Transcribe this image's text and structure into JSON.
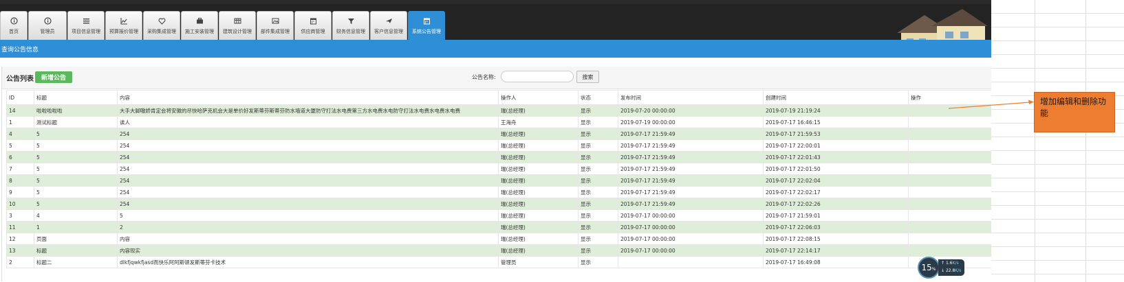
{
  "nav": {
    "tabs": [
      {
        "label": "首页",
        "icon": "info-icon"
      },
      {
        "label": "管理员",
        "icon": "info-icon"
      },
      {
        "label": "项目信息管理",
        "icon": "list-icon"
      },
      {
        "label": "预算报价管理",
        "icon": "chart-icon"
      },
      {
        "label": "采购集成管理",
        "icon": "heart-icon"
      },
      {
        "label": "施工安装管理",
        "icon": "briefcase-icon"
      },
      {
        "label": "建筑设计管理",
        "icon": "table-icon"
      },
      {
        "label": "部件集成管理",
        "icon": "picture-icon"
      },
      {
        "label": "供应商管理",
        "icon": "calendar-icon"
      },
      {
        "label": "财务信息管理",
        "icon": "filter-icon"
      },
      {
        "label": "客户信息管理",
        "icon": "plane-icon"
      },
      {
        "label": "系统公告管理",
        "icon": "calendar-icon"
      }
    ],
    "active_index": 11
  },
  "page_title": "查询公告信息",
  "toolbar": {
    "list_title": "公告列表",
    "add_button": "新增公告",
    "search_label": "公告名称:",
    "search_value": "",
    "search_button": "搜索"
  },
  "table": {
    "headers": [
      "ID",
      "标题",
      "内容",
      "操作人",
      "状态",
      "发布时间",
      "创建时间",
      "操作"
    ],
    "rows": [
      [
        "14",
        "啦啦啦啦啦",
        "大手大脚嗷娇肯定会将安徽的尽快哈萨克机会大是单价好发斯蒂芬斯蒂芬防水墙道大厦防守打法水电费第三方水电费水电防守打法水电费水电费水电费",
        "瑞(总经理)",
        "显示",
        "2019-07-20 00:00:00",
        "2019-07-19 21:19:24",
        ""
      ],
      [
        "1",
        "测试标题",
        "诶人",
        "王海舟",
        "显示",
        "2019-07-19 00:00:00",
        "2019-07-17 16:46:15",
        ""
      ],
      [
        "4",
        "5",
        "254",
        "瑞(总经理)",
        "显示",
        "2019-07-17 21:59:49",
        "2019-07-17 21:59:53",
        ""
      ],
      [
        "5",
        "5",
        "254",
        "瑞(总经理)",
        "显示",
        "2019-07-17 21:59:49",
        "2019-07-17 22:00:01",
        ""
      ],
      [
        "6",
        "5",
        "254",
        "瑞(总经理)",
        "显示",
        "2019-07-17 21:59:49",
        "2019-07-17 22:01:43",
        ""
      ],
      [
        "7",
        "5",
        "254",
        "瑞(总经理)",
        "显示",
        "2019-07-17 21:59:49",
        "2019-07-17 22:01:50",
        ""
      ],
      [
        "8",
        "5",
        "254",
        "瑞(总经理)",
        "显示",
        "2019-07-17 21:59:49",
        "2019-07-17 22:02:04",
        ""
      ],
      [
        "9",
        "5",
        "254",
        "瑞(总经理)",
        "显示",
        "2019-07-17 21:59:49",
        "2019-07-17 22:02:17",
        ""
      ],
      [
        "10",
        "5",
        "254",
        "瑞(总经理)",
        "显示",
        "2019-07-17 21:59:49",
        "2019-07-17 22:02:26",
        ""
      ],
      [
        "3",
        "4",
        "5",
        "瑞(总经理)",
        "显示",
        "2019-07-17 00:00:00",
        "2019-07-17 21:59:01",
        ""
      ],
      [
        "11",
        "1",
        "2",
        "瑞(总经理)",
        "显示",
        "2019-07-17 00:00:00",
        "2019-07-17 22:06:03",
        ""
      ],
      [
        "12",
        "页面",
        "内容",
        "瑞(总经理)",
        "显示",
        "2019-07-17 00:00:00",
        "2019-07-17 22:08:15",
        ""
      ],
      [
        "13",
        "标题",
        "内容现实",
        "瑞(总经理)",
        "显示",
        "2019-07-17 00:00:00",
        "2019-07-17 22:14:17",
        ""
      ],
      [
        "2",
        "标题二",
        "dlkfjqwkfjasd而快乐阿阿斯顿发斯蒂芬卡技术",
        "管理员",
        "显示",
        "",
        "2019-07-17 16:49:08",
        ""
      ]
    ]
  },
  "annotation": {
    "text": "增加编辑和删除功能"
  },
  "net_widget": {
    "value": "15",
    "unit": "%",
    "up": "1.6",
    "up_unit": "K/s",
    "down": "22.8",
    "down_unit": "K/s"
  },
  "colors": {
    "nav_bg": "#232323",
    "accent_blue": "#2f8fd6",
    "add_button_green": "#5cb85c",
    "row_stripe_green": "#dfeed8",
    "callout_orange": "#ed7d31"
  }
}
